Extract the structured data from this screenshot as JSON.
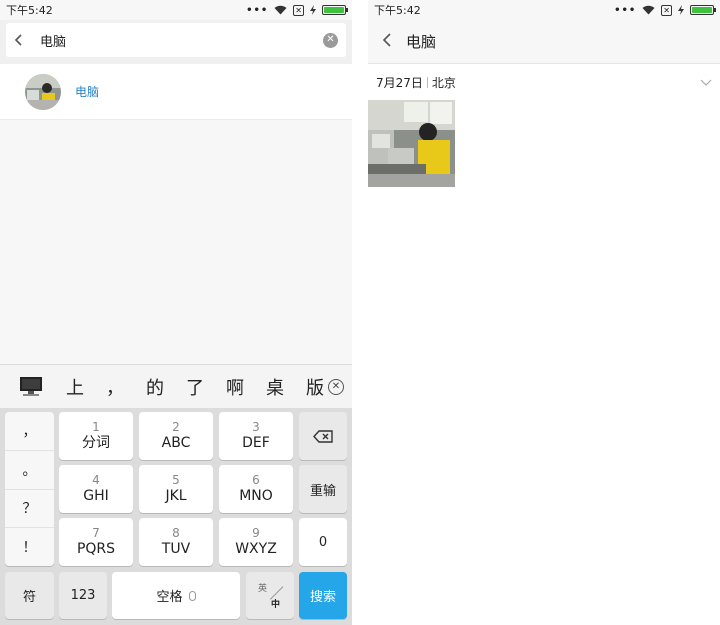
{
  "left": {
    "status": {
      "time": "下午5:42",
      "dots": "•••"
    },
    "search": {
      "value": "电脑",
      "back_icon": "back-arrow-icon",
      "clear_icon": "clear-icon"
    },
    "result": {
      "label": "电脑"
    },
    "candidates": [
      "上",
      "，",
      "的",
      "了",
      "啊",
      "桌",
      "版"
    ],
    "keyboard": {
      "punctuation": [
        "，",
        "。",
        "？",
        "！"
      ],
      "keys": [
        {
          "num": "1",
          "letters": "分词"
        },
        {
          "num": "2",
          "letters": "ABC"
        },
        {
          "num": "3",
          "letters": "DEF"
        },
        {
          "num": "4",
          "letters": "GHI"
        },
        {
          "num": "5",
          "letters": "JKL"
        },
        {
          "num": "6",
          "letters": "MNO"
        },
        {
          "num": "7",
          "letters": "PQRS"
        },
        {
          "num": "8",
          "letters": "TUV"
        },
        {
          "num": "9",
          "letters": "WXYZ"
        }
      ],
      "reenter": "重输",
      "zero": "0",
      "symbol": "符",
      "num_mode": "123",
      "space": "空格",
      "lang_top": "英",
      "lang_bottom": "中",
      "search": "搜索"
    }
  },
  "right": {
    "status": {
      "time": "下午5:42",
      "dots": "•••"
    },
    "title": "电脑",
    "date": "7月27日",
    "location": "北京"
  },
  "colors": {
    "accent_blue": "#24a6e9",
    "link_blue": "#2b83c9",
    "battery_green": "#3ec33e"
  }
}
